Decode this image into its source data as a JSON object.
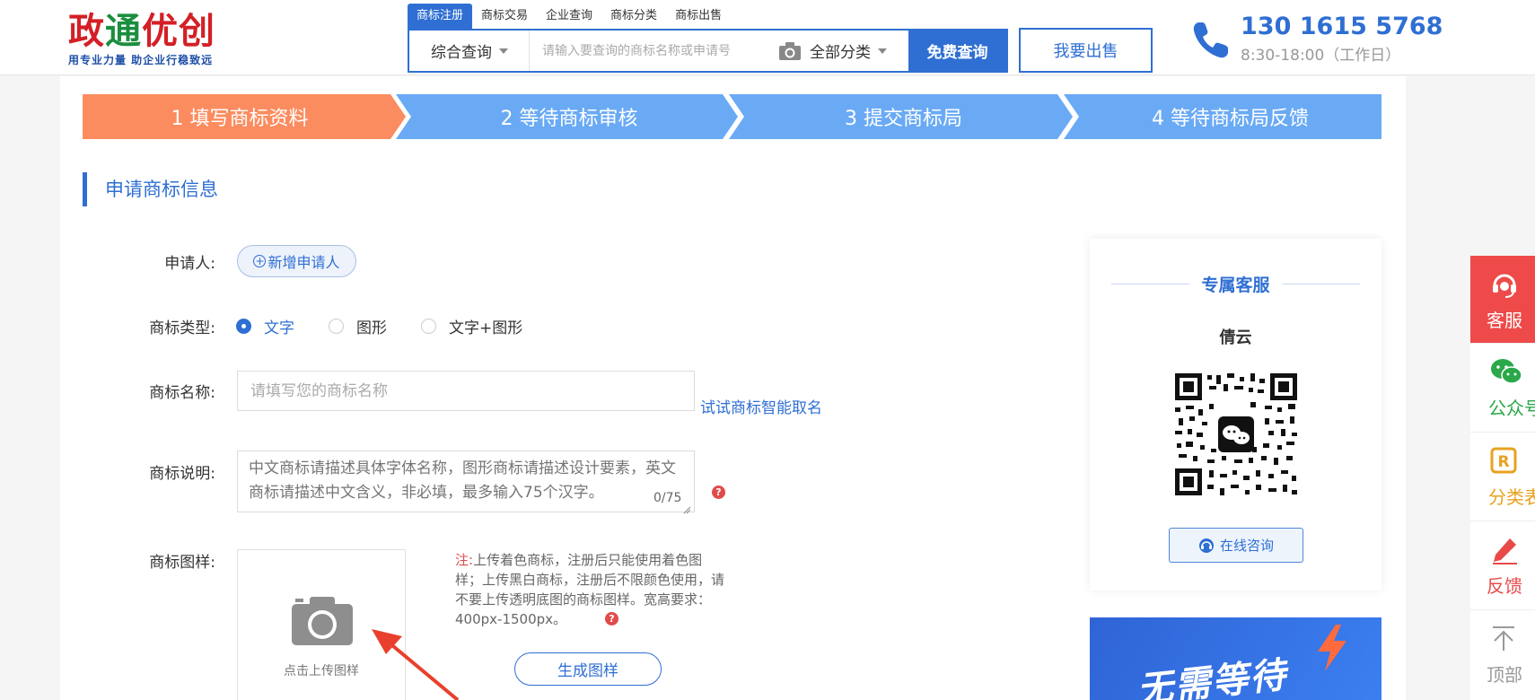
{
  "header": {
    "logo_title_part1": "政",
    "logo_title_part2": "通",
    "logo_title_part3": "优创",
    "logo_slogan": "用专业力量 助企业行稳致远",
    "search_tabs": [
      "商标注册",
      "商标交易",
      "企业查询",
      "商标分类",
      "商标出售"
    ],
    "search_scope": "综合查询",
    "search_placeholder": "请输入要查询的商标名称或申请号",
    "search_category": "全部分类",
    "search_button": "免费查询",
    "sell_button": "我要出售",
    "phone_number": "130 1615 5768",
    "phone_hours": "8:30-18:00（工作日）"
  },
  "steps": [
    {
      "label": "1 填写商标资料",
      "color": "#fb8c5f"
    },
    {
      "label": "2 等待商标审核",
      "color": "#6aaaf5"
    },
    {
      "label": "3 提交商标局",
      "color": "#6aaaf5"
    },
    {
      "label": "4 等待商标局反馈",
      "color": "#6aaaf5"
    }
  ],
  "form": {
    "section_title": "申请商标信息",
    "applicant_label": "申请人:",
    "add_applicant_button": "新增申请人",
    "type_label": "商标类型:",
    "type_options": [
      "文字",
      "图形",
      "文字+图形"
    ],
    "type_selected": "文字",
    "name_label": "商标名称:",
    "name_placeholder": "请填写您的商标名称",
    "try_naming_link": "试试商标智能取名",
    "desc_label": "商标说明:",
    "desc_placeholder": "中文商标请描述具体字体名称，图形商标请描述设计要素，英文商标请描述中文含义，非必填，最多输入75个汉字。",
    "desc_counter": "0/75",
    "image_label": "商标图样:",
    "upload_text": "点击上传图样",
    "note_prefix": "注:",
    "note_text": "上传着色商标，注册后只能使用着色图样；上传黑白商标，注册后不限颜色使用，请不要上传透明底图的商标图样。宽高要求：400px-1500px。",
    "generate_button": "生成图样",
    "help_icon_text": "?"
  },
  "service": {
    "title": "专属客服",
    "name": "倩云",
    "consult_button": "在线咨询"
  },
  "banner": {
    "text": "无需等待"
  },
  "sidebar": {
    "items": [
      "客服",
      "公众号",
      "分类表",
      "反馈",
      "顶部"
    ]
  },
  "colors": {
    "primary": "#2f6fd3",
    "accent_red": "#ee4a4a",
    "step_active": "#fb8c5f",
    "step_inactive": "#6aaaf5"
  }
}
